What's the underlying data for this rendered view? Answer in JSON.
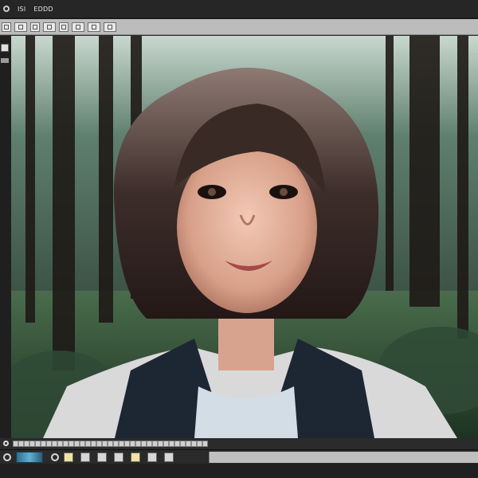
{
  "menu": {
    "items": [
      {
        "label": "ISI"
      },
      {
        "label": "EDDD"
      }
    ]
  },
  "toolbar": {
    "buttons": [
      "file-icon",
      "grid-icon",
      "layers-icon",
      "crop-icon",
      "brush-icon",
      "select-icon",
      "zoom-icon",
      "filter-icon"
    ]
  },
  "bottombar": {
    "buttons": [
      "prev-frame-icon",
      "layer-icon",
      "flag-icon",
      "export-icon",
      "image-icon",
      "film-icon",
      "settings-icon"
    ]
  },
  "colors": {
    "canvas_bg": "#233028",
    "toolbar_bg": "#bcbcbc",
    "titlebar_bg": "#262626"
  }
}
